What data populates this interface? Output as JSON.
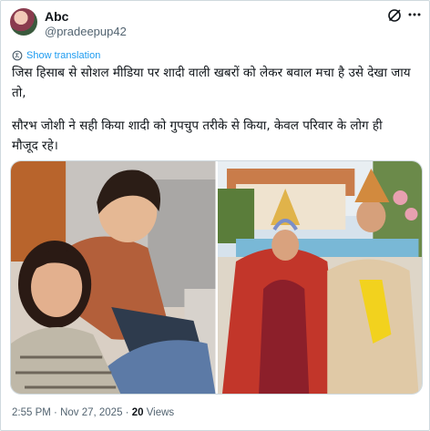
{
  "author": {
    "display_name": "Abc",
    "handle": "@pradeepup42"
  },
  "translate_label": "Show translation",
  "tweet": {
    "line1": "जिस हिसाब से सोशल मीडिया पर शादी वाली खबरों को लेकर बवाल मचा है उसे देखा जाय",
    "line2": "तो,",
    "line3": "सौरभ जोशी ने सही किया शादी को गुपचुप तरीके से किया, केवल परिवार के लोग ही",
    "line4": "मौजूद रहे।"
  },
  "meta": {
    "time": "2:55 PM",
    "separator": " · ",
    "date": "Nov 27, 2025",
    "views_count": "20",
    "views_label": " Views"
  },
  "icons": {
    "grok": "grok-icon",
    "more": "more-icon",
    "translate": "translate-icon"
  },
  "colors": {
    "link": "#1d9bf0",
    "muted": "#536471",
    "text": "#0f1419"
  }
}
